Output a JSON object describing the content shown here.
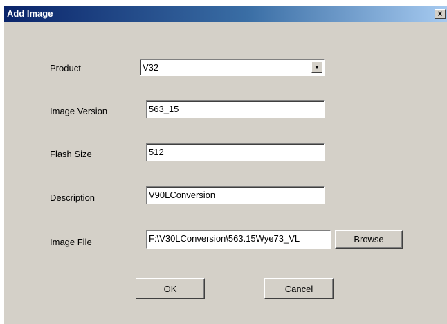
{
  "window": {
    "title": "Add Image",
    "close_symbol": "×"
  },
  "form": {
    "product": {
      "label": "Product",
      "value": "V32"
    },
    "image_version": {
      "label": "Image Version",
      "value": "563_15"
    },
    "flash_size": {
      "label": "Flash Size",
      "value": "512"
    },
    "description": {
      "label": "Description",
      "value": "V90LConversion"
    },
    "image_file": {
      "label": "Image File",
      "value": "F:\\V30LConversion\\563.15Wye73_VL"
    }
  },
  "buttons": {
    "browse": "Browse",
    "ok": "OK",
    "cancel": "Cancel"
  },
  "colors": {
    "titlebar_start": "#0a246a",
    "titlebar_end": "#a6caf0",
    "dialog_bg": "#d4d0c8"
  },
  "icons": {
    "close": "close-icon",
    "dropdown": "chevron-down-icon"
  }
}
